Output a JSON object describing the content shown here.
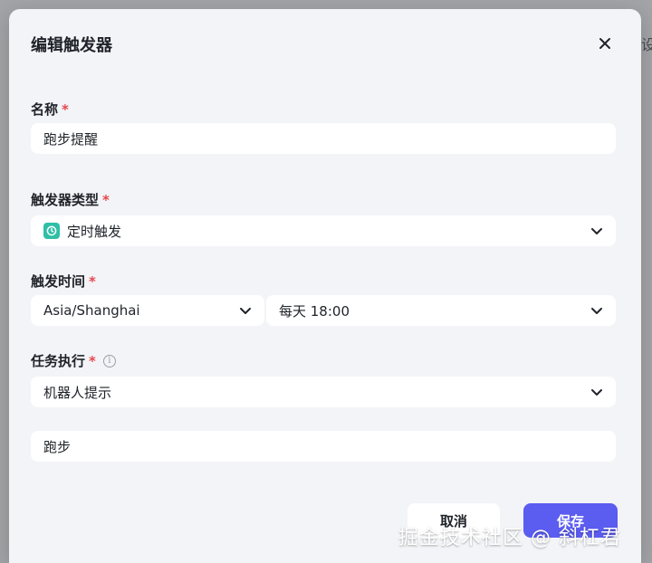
{
  "modal": {
    "title": "编辑触发器"
  },
  "name_field": {
    "label": "名称",
    "required": "*",
    "value": "跑步提醒"
  },
  "trigger_type": {
    "label": "触发器类型",
    "required": "*",
    "value": "定时触发",
    "icon": "timer-icon"
  },
  "trigger_time": {
    "label": "触发时间",
    "required": "*",
    "timezone": "Asia/Shanghai",
    "schedule": "每天 18:00"
  },
  "task_exec": {
    "label": "任务执行",
    "required": "*",
    "value": "机器人提示",
    "content": "跑步"
  },
  "buttons": {
    "cancel": "取消",
    "save": "保存"
  },
  "watermark": "掘金技术社区 @ 斜杠君",
  "colors": {
    "accent": "#5b5cf0",
    "required": "#e5484d",
    "timer_icon": "#2fbfa7"
  }
}
